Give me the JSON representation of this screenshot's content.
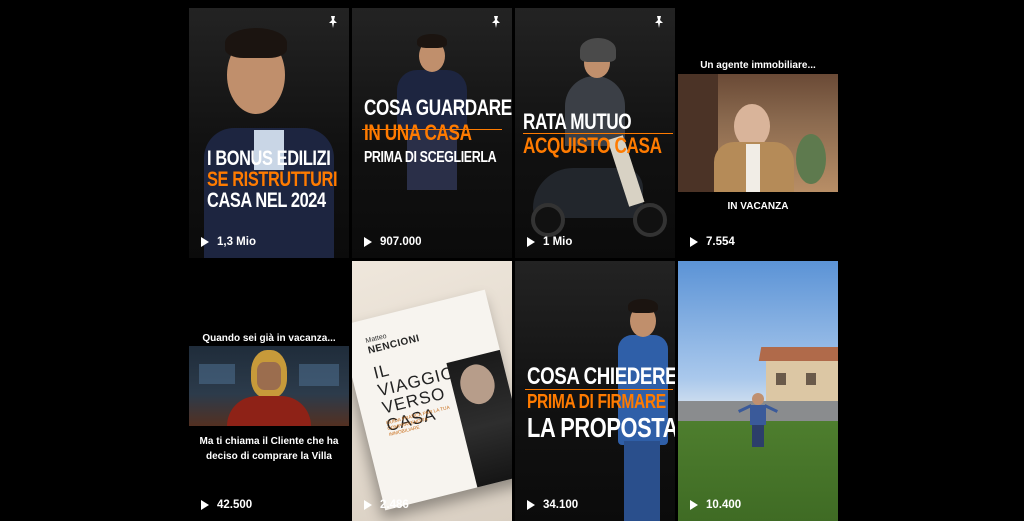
{
  "posts": [
    {
      "views": "1,3 Mio",
      "pinned": true,
      "lines": [
        "I BONUS EDILIZI",
        "SE RISTRUTTURI",
        "CASA NEL 2024"
      ]
    },
    {
      "views": "907.000",
      "pinned": true,
      "lines": [
        "COSA GUARDARE",
        "IN UNA CASA",
        "PRIMA DI SCEGLIERLA"
      ]
    },
    {
      "views": "1 Mio",
      "pinned": true,
      "lines": [
        "RATA MUTUO",
        "ACQUISTO CASA"
      ]
    },
    {
      "views": "7.554",
      "pinned": false,
      "top_caption": "Un agente immobiliare...",
      "bottom_caption": "IN VACANZA"
    },
    {
      "views": "42.500",
      "pinned": false,
      "top_caption": "Quando sei già in vacanza...",
      "bottom_caption": "Ma ti chiama il Cliente che ha deciso di comprare la Villa"
    },
    {
      "views": "2.486",
      "pinned": false,
      "book_author_first": "Matteo",
      "book_author_last": "NENCIONI",
      "book_title": "IL VIAGGIO VERSO CASA",
      "book_subtitle": "GUIDA PRATICA PER LA TUA COMPRAVENDITA IMMOBILIARE"
    },
    {
      "views": "34.100",
      "pinned": false,
      "lines": [
        "COSA CHIEDERE",
        "PRIMA DI FIRMARE",
        "LA PROPOSTA"
      ]
    },
    {
      "views": "10.400",
      "pinned": false
    }
  ],
  "colors": {
    "accent": "#ff7b00",
    "background": "#000000",
    "text": "#ffffff"
  },
  "icons": {
    "pin": "pin-icon",
    "play": "play-icon"
  }
}
